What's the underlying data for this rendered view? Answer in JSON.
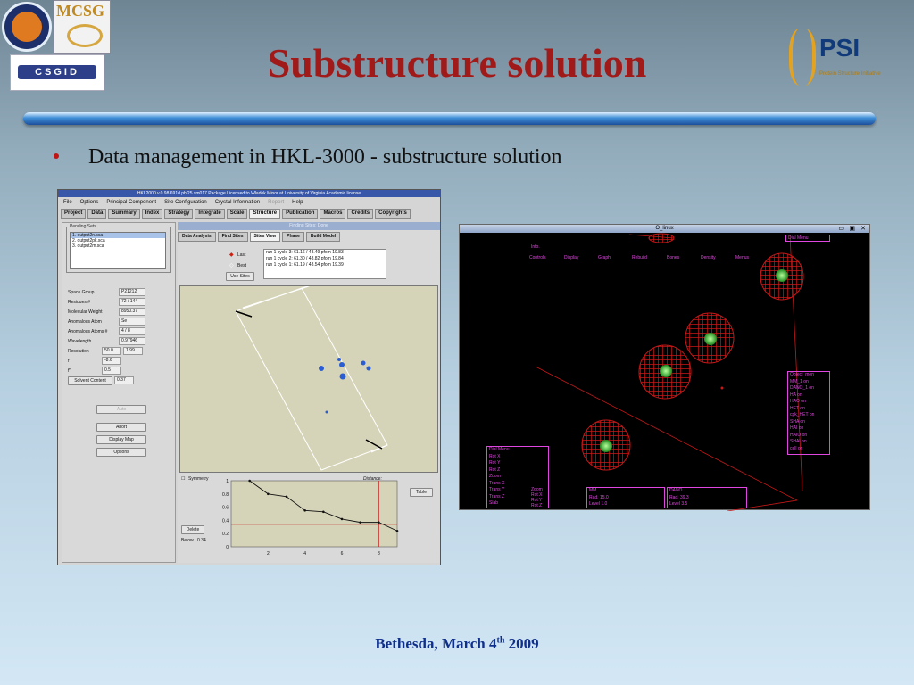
{
  "slide": {
    "title": "Substructure solution",
    "bullet": "Data management in HKL-3000 - substructure solution",
    "footer_prefix": "Bethesda, March 4",
    "footer_sup": "th",
    "footer_suffix": "2009"
  },
  "logos": {
    "mcsg": "MCSG",
    "csgid": "CSGID",
    "psi": "PSI",
    "psi_sub": "Protein Structure Initiative"
  },
  "hkl": {
    "title": "HKL2000 v.0.98.691d.phi25.sm017   Package Licensed to Wladek Minor at University of Virginia   Academic license",
    "menu": [
      "File",
      "Options",
      "Principal Component",
      "Site Configuration",
      "Crystal Information",
      "Report",
      "Help"
    ],
    "tabs": [
      "Project",
      "Data",
      "Summary",
      "Index",
      "Strategy",
      "Integrate",
      "Scale",
      "Structure",
      "Publication",
      "Macros",
      "Credits",
      "Copyrights"
    ],
    "pending_label": "Pending Sets",
    "pending_sets": [
      "1. output2n.sca",
      "2. output2pk.sca",
      "3. output2m.sca"
    ],
    "params": [
      {
        "label": "Space Group",
        "value": "P21212"
      },
      {
        "label": "Residues #",
        "value": "72 / 144"
      },
      {
        "label": "Molecular Weight",
        "value": "8950.37"
      },
      {
        "label": "Anomalous Atom",
        "value": "Se"
      },
      {
        "label": "Anomalous Atoms #",
        "value": "4 / 8"
      },
      {
        "label": "Wavelength",
        "value": "0.97946"
      }
    ],
    "resolution_label": "Resolution",
    "resolution_low": "50.0",
    "resolution_high": "1.99",
    "f1_label": "f'",
    "f1_value": "-8.6",
    "f2_label": "f''",
    "f2_value": "0.5",
    "solvent_label": "Solvent Content",
    "solvent_value": "0.37",
    "auto_button": "Auto",
    "abort_button": "Abort",
    "display_map_button": "Display Map",
    "options_button": "Options",
    "finding_status": "Finding Sites: Done",
    "right_tabs": [
      "Data Analysis",
      "Find Sites",
      "Sites View",
      "Phase",
      "Build Model"
    ],
    "radio_last": "Last",
    "radio_best": "Best",
    "use_sites_button": "Use Sites",
    "runs": [
      "run 1 cycle 3:  61.16  /  48.49  pfom  19.83",
      "run 1 cycle 2:  61.30  /  48.82  pfom  19.84",
      "run 1 cycle 1:  61.19  /  48.54  pfom  19.39"
    ],
    "symmetry_label": "Symmetry",
    "distance_label": "Distance:",
    "table_button": "Table",
    "delete_button": "Delete",
    "below_label": "Below",
    "below_value": "0.34"
  },
  "chart_data": {
    "type": "line",
    "x": [
      1,
      2,
      3,
      4,
      5,
      6,
      7,
      8,
      9
    ],
    "values": [
      1.0,
      0.8,
      0.76,
      0.55,
      0.53,
      0.42,
      0.37,
      0.37,
      0.24
    ],
    "threshold_y": 0.34,
    "marker_x": 8,
    "y_ticks": [
      "1",
      "0.8",
      "0.6",
      "0.4",
      "0.2",
      "0"
    ],
    "x_ticks": [
      "2",
      "4",
      "6",
      "8"
    ],
    "ylim": [
      0,
      1
    ],
    "xlim": [
      0,
      9
    ]
  },
  "owin": {
    "title": "O_linux",
    "menu": [
      "Controls",
      "Display",
      "Graph",
      "Rebuild",
      "Bones",
      "Density",
      "Menus"
    ],
    "info": "Info.",
    "dial_menu_top": "Dial Menu",
    "object_menu_title": "Object_men",
    "object_items": [
      "MM_1    on",
      "DANO_1   on",
      "HA      on",
      "HAO     on",
      "HET     on",
      "cpk_HET on",
      "SHA     on",
      "HAI     on",
      "HAIO    on",
      "SHAI    on",
      "cell    on"
    ],
    "dial_menu_title": "Dial Menu",
    "dial_items": [
      "Rot X",
      "Rot Y",
      "Rot Z",
      "Zoom",
      "Trans X",
      "Trans Y",
      "Trans Z",
      "Slab"
    ],
    "dial_side": [
      "Zoom",
      "Rot X",
      "Rot Y",
      "Rot Z"
    ],
    "mm_label": "MM",
    "mm_rad": "Rad.  15.0",
    "mm_level": "Level  1.0",
    "dano_label": "DANO",
    "dano_rad": "Rad.  39.3",
    "dano_level": "Level  3.5"
  }
}
